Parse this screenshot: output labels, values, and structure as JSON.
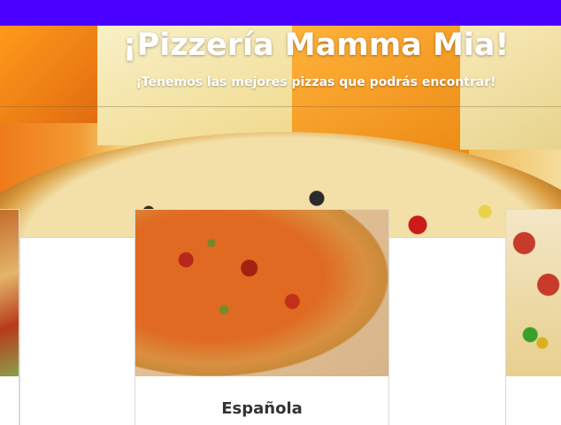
{
  "hero": {
    "title": "¡Pizzería Mamma Mia!",
    "subtitle": "¡Tenemos las mejores pizzas que podrás encontrar!"
  },
  "cards": [
    {
      "title": "Española"
    }
  ],
  "colors": {
    "topbar": "#4a00ff",
    "title_text": "#ffffff",
    "card_title": "#333333"
  }
}
